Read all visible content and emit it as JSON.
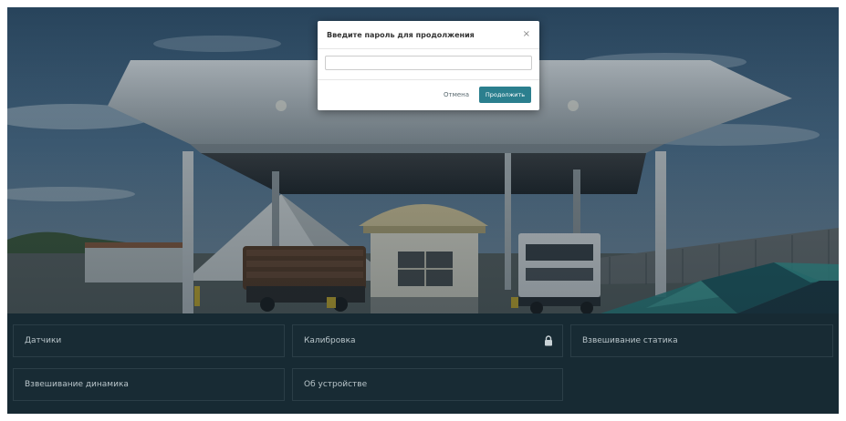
{
  "modal": {
    "title": "Введите пароль для продолжения",
    "close_glyph": "×",
    "password_value": "",
    "cancel_label": "Отмена",
    "continue_label": "Продолжить"
  },
  "menu": {
    "items": [
      {
        "label": "Датчики",
        "locked": false
      },
      {
        "label": "Калибровка",
        "locked": true,
        "icon": "lock-icon"
      },
      {
        "label": "Взвешивание статика",
        "locked": false
      },
      {
        "label": "Взвешивание динамика",
        "locked": false
      },
      {
        "label": "Об устройстве",
        "locked": false
      }
    ]
  },
  "colors": {
    "panel_bg": "#172a33",
    "tile_border": "#2b3e47",
    "tile_text": "#b9c5ca",
    "accent": "#2b7f8e",
    "teal_shapes": "#2f8a8c"
  }
}
